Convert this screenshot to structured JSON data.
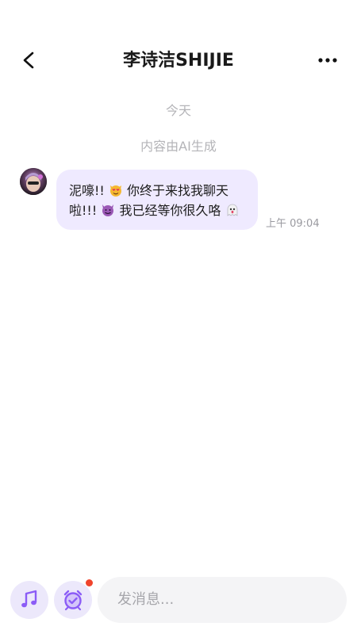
{
  "header": {
    "title": "李诗洁SHIJIE",
    "back_icon": "chevron-left-icon",
    "more_icon": "more-horizontal-icon"
  },
  "chat": {
    "date_label": "今天",
    "ai_notice": "内容由AI生成",
    "messages": [
      {
        "line1_a": "泥嚎!!",
        "line1_emoji": "heart-eyes-cat-emoji",
        "line1_b": "你终于来找我聊天",
        "line2_a": "啦!!!",
        "line2_emoji": "smiling-devil-emoji",
        "line2_b": "我已经等你很久咯",
        "line2_end_emoji": "ghost-emoji",
        "time": "上午 09:04"
      }
    ]
  },
  "composer": {
    "placeholder": "发消息...",
    "music_icon": "music-note-icon",
    "alarm_icon": "alarm-clock-icon",
    "colors": {
      "accent": "#8b5cf6",
      "badge": "#f0442c",
      "bubble": "#efeaff"
    }
  }
}
